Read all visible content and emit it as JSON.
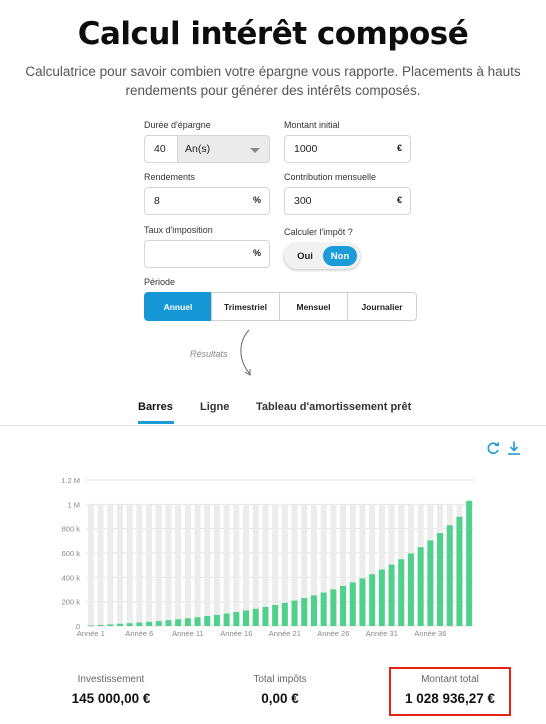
{
  "header": {
    "title": "Calcul intérêt composé",
    "subtitle_line1": "Calculatrice pour savoir combien votre épargne vous rapporte. Placements à hauts",
    "subtitle_line2": "rendements pour générer des intérêts composés."
  },
  "form": {
    "duree_label": "Durée d'épargne",
    "duree_value": "40",
    "duree_unit": "An(s)",
    "montant_label": "Montant initial",
    "montant_value": "1000",
    "montant_unit": "€",
    "rendements_label": "Rendements",
    "rendements_value": "8",
    "rendements_unit": "%",
    "contribution_label": "Contribution mensuelle",
    "contribution_value": "300",
    "contribution_unit": "€",
    "taux_label": "Taux d'imposition",
    "taux_value": "",
    "taux_unit": "%",
    "impot_label": "Calculer l'impôt ?",
    "impot_oui": "Oui",
    "impot_non": "Non",
    "periode_label": "Période",
    "periodes": [
      "Annuel",
      "Trimestriel",
      "Mensuel",
      "Journalier"
    ],
    "periode_selected": "Annuel"
  },
  "resultats_label": "Résultats",
  "tabs": [
    "Barres",
    "Ligne",
    "Tableau d'amortissement prêt"
  ],
  "active_tab": "Barres",
  "icons": {
    "refresh": "refresh-icon",
    "download": "download-icon"
  },
  "colors": {
    "accent": "#1b9bd7",
    "bar": "#4fd18b",
    "bar_bg": "#ececec",
    "highlight": "#e52416"
  },
  "chart_data": {
    "type": "bar",
    "x_tick_labels": [
      "Année 1",
      "Année 6",
      "Année 11",
      "Année 16",
      "Année 21",
      "Année 26",
      "Année 31",
      "Année 36"
    ],
    "y_tick_labels": [
      "0",
      "200 k",
      "400 k",
      "600 k",
      "800 k",
      "1 M",
      "1.2 M"
    ],
    "ylim": [
      0,
      1200000
    ],
    "grid": true,
    "categories": [
      "Année 1",
      "Année 2",
      "Année 3",
      "Année 4",
      "Année 5",
      "Année 6",
      "Année 7",
      "Année 8",
      "Année 9",
      "Année 10",
      "Année 11",
      "Année 12",
      "Année 13",
      "Année 14",
      "Année 15",
      "Année 16",
      "Année 17",
      "Année 18",
      "Année 19",
      "Année 20",
      "Année 21",
      "Année 22",
      "Année 23",
      "Année 24",
      "Année 25",
      "Année 26",
      "Année 27",
      "Année 28",
      "Année 29",
      "Année 30",
      "Année 31",
      "Année 32",
      "Année 33",
      "Année 34",
      "Année 35",
      "Année 36",
      "Année 37",
      "Année 38",
      "Année 39",
      "Année 40"
    ],
    "values": [
      4680,
      8735,
      13112,
      17840,
      22946,
      28462,
      34418,
      40851,
      47799,
      55302,
      63406,
      72159,
      81611,
      91820,
      102846,
      114754,
      127614,
      141503,
      156503,
      172703,
      190199,
      209095,
      229503,
      251544,
      275347,
      301055,
      328820,
      358806,
      391191,
      426166,
      463939,
      504734,
      548793,
      596377,
      647767,
      703268,
      763209,
      827946,
      897862,
      1028936
    ]
  },
  "summary": {
    "investissement_label": "Investissement",
    "investissement_value": "145 000,00 €",
    "impots_label": "Total impôts",
    "impots_value": "0,00 €",
    "total_label": "Montant total",
    "total_value": "1 028 936,27 €"
  }
}
